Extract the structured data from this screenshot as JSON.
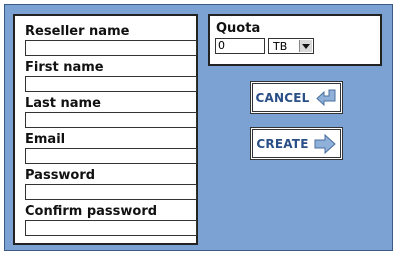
{
  "form": {
    "fields": [
      {
        "label": "Reseller name",
        "value": ""
      },
      {
        "label": "First name",
        "value": ""
      },
      {
        "label": "Last name",
        "value": ""
      },
      {
        "label": "Email",
        "value": ""
      },
      {
        "label": "Password",
        "value": ""
      },
      {
        "label": "Confirm password",
        "value": ""
      }
    ]
  },
  "quota": {
    "label": "Quota",
    "value": "0",
    "unit": "TB"
  },
  "buttons": {
    "cancel": {
      "label": "CANCEL",
      "icon": "return-arrow-icon"
    },
    "create": {
      "label": "CREATE",
      "icon": "right-arrow-icon"
    }
  },
  "colors": {
    "background": "#7ba2d3",
    "button_text": "#2a4f86",
    "icon_fill": "#8fb0d8"
  }
}
